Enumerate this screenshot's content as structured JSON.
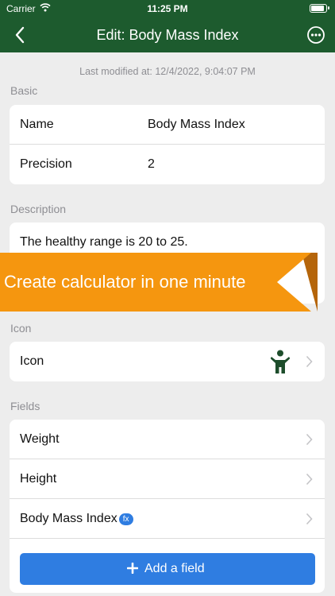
{
  "status_bar": {
    "carrier": "Carrier",
    "time": "11:25 PM",
    "battery_level": 0.92
  },
  "nav": {
    "title": "Edit: Body Mass Index"
  },
  "last_modified": "Last modified at: 12/4/2022, 9:04:07 PM",
  "basic": {
    "header": "Basic",
    "rows": [
      {
        "label": "Name",
        "value": "Body Mass Index"
      },
      {
        "label": "Precision",
        "value": "2"
      }
    ]
  },
  "description": {
    "header": "Description",
    "text": "The healthy range is 20 to 25."
  },
  "icon": {
    "header": "Icon",
    "label": "Icon",
    "icon_name": "person-icon"
  },
  "fields": {
    "header": "Fields",
    "items": [
      {
        "label": "Weight"
      },
      {
        "label": "Height"
      },
      {
        "label": "Body Mass Index",
        "badge": "fx"
      }
    ],
    "add_label": "Add a field"
  },
  "banner": {
    "text": "Create calculator in one minute"
  },
  "colors": {
    "nav_green": "#1d5b2e",
    "accent_blue": "#2f7de1",
    "banner_orange": "#f5960f",
    "background": "#ededed"
  }
}
